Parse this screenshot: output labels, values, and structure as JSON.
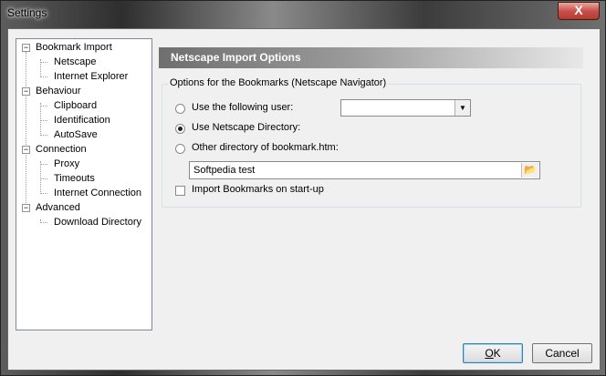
{
  "window": {
    "title": "Settings",
    "close_label": "X"
  },
  "tree": {
    "items": [
      {
        "label": "Bookmark Import",
        "level": 0,
        "expander": "−"
      },
      {
        "label": "Netscape",
        "level": 1
      },
      {
        "label": "Internet Explorer",
        "level": 1
      },
      {
        "label": "Behaviour",
        "level": 0,
        "expander": "−"
      },
      {
        "label": "Clipboard",
        "level": 1
      },
      {
        "label": "Identification",
        "level": 1
      },
      {
        "label": "AutoSave",
        "level": 1
      },
      {
        "label": "Connection",
        "level": 0,
        "expander": "−"
      },
      {
        "label": "Proxy",
        "level": 1
      },
      {
        "label": "Timeouts",
        "level": 1
      },
      {
        "label": "Internet Connection",
        "level": 1
      },
      {
        "label": "Advanced",
        "level": 0,
        "expander": "−"
      },
      {
        "label": "Download Directory",
        "level": 1
      }
    ]
  },
  "panel": {
    "header": "Netscape Import Options",
    "group_label": "Options for the Bookmarks (Netscape Navigator)",
    "radio_user": "Use the following user:",
    "radio_netscape_dir": "Use Netscape Directory:",
    "radio_other_dir": "Other directory of bookmark.htm:",
    "selected_option": "Use Netscape Directory:",
    "user_combo_value": "",
    "directory_value": "Softpedia test",
    "checkbox_import": "Import Bookmarks on start-up",
    "checkbox_checked": false
  },
  "buttons": {
    "ok_accel": "O",
    "ok_rest": "K",
    "cancel": "Cancel"
  },
  "icons": {
    "browse": "folder-open-icon",
    "combo_arrow": "chevron-down-icon"
  }
}
